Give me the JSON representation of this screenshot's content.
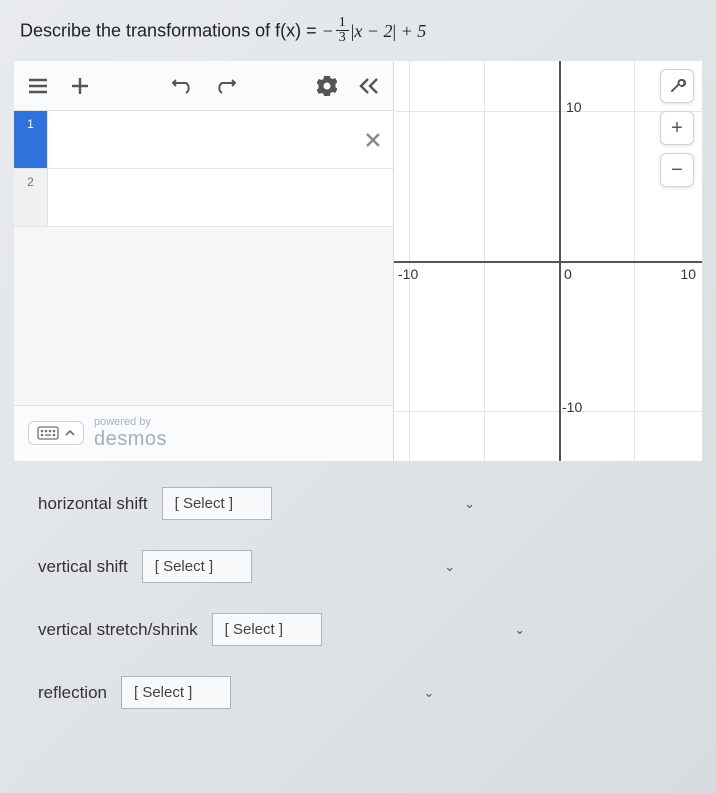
{
  "prompt": {
    "prefix": "Describe the transformations of f(x) = ",
    "minus": "−",
    "frac_num": "1",
    "frac_den": "3",
    "bar": "|",
    "var": "x",
    "minus2": " − 2",
    "bar2": "|",
    "plus5": " + 5"
  },
  "toolbar": {
    "menu": "menu",
    "add": "add",
    "undo": "undo",
    "redo": "redo",
    "settings": "settings",
    "collapse": "collapse"
  },
  "rows": [
    {
      "index": "1",
      "active": true
    },
    {
      "index": "2",
      "active": false
    }
  ],
  "footer": {
    "powered": "powered by",
    "brand": "desmos"
  },
  "graph": {
    "ticks": {
      "neg10": "-10",
      "zero": "0",
      "pos10": "10",
      "ypos10": "10",
      "yneg10": "-10"
    },
    "tools": {
      "wrench": "🔧",
      "plus": "+",
      "minus": "−"
    }
  },
  "answers": {
    "hshift": {
      "label": "horizontal shift",
      "placeholder": "[ Select ]"
    },
    "vshift": {
      "label": "vertical shift",
      "placeholder": "[ Select ]"
    },
    "stretch": {
      "label": "vertical stretch/shrink",
      "placeholder": "[ Select ]"
    },
    "reflect": {
      "label": "reflection",
      "placeholder": "[ Select ]"
    }
  }
}
